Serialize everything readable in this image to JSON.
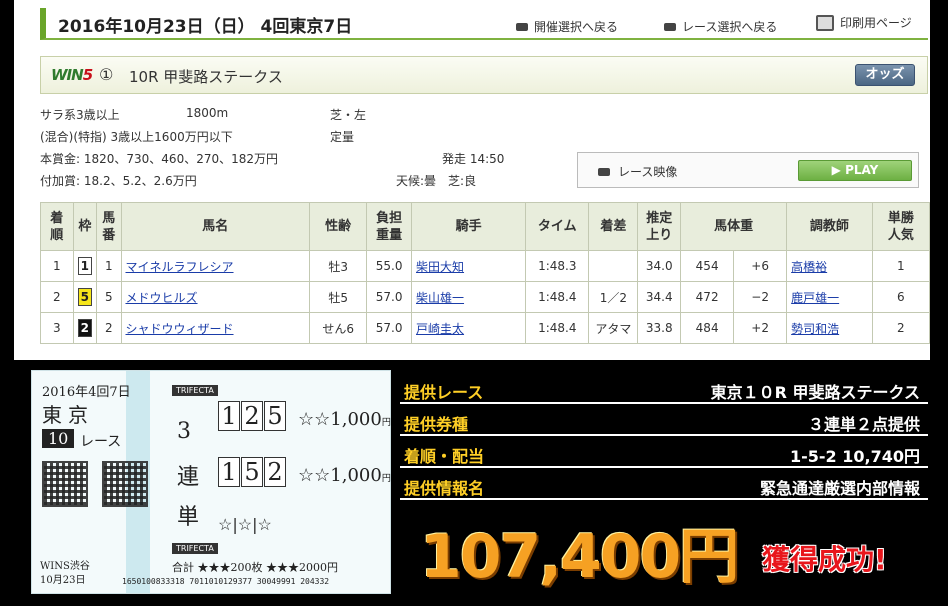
{
  "header": {
    "date_title": "2016年10月23日（日） 4回東京7日",
    "back_meeting": "開催選択へ戻る",
    "back_race": "レース選択へ戻る",
    "print_page": "印刷用ページ"
  },
  "race": {
    "win5_logo_a": "WIN",
    "win5_logo_b": "5",
    "leg": "①",
    "name": "10R 甲斐路ステークス",
    "odds_label": "オッズ",
    "class": "サラ系3歳以上",
    "distance": "1800m",
    "surface": "芝・左",
    "condition": "(混合)(特指) 3歳以上1600万円以下",
    "weight_rule": "定量",
    "prize": "本賞金:  1820、730、460、270、182万円",
    "start": "発走 14:50",
    "bonus": "付加賞:  18.2、5.2、2.6万円",
    "weather": "天候:曇　芝:良",
    "video_label": "レース映像",
    "play_label": "PLAY"
  },
  "table": {
    "headers": [
      "着\n順",
      "枠",
      "馬\n番",
      "馬名",
      "性齢",
      "負担\n重量",
      "騎手",
      "タイム",
      "着差",
      "推定\n上り",
      "馬体重",
      "",
      "調教師",
      "単勝\n人気"
    ],
    "rows": [
      {
        "pos": "1",
        "waku": "1",
        "uma": "1",
        "horse": "マイネルラフレシア",
        "sex": "牡3",
        "kg": "55.0",
        "jockey": "柴田大知",
        "time": "1:48.3",
        "margin": "",
        "agari": "34.0",
        "bw": "454",
        "diff": "+6",
        "trainer": "高橋裕",
        "pop": "1"
      },
      {
        "pos": "2",
        "waku": "5",
        "uma": "5",
        "horse": "メドウヒルズ",
        "sex": "牡5",
        "kg": "57.0",
        "jockey": "柴山雄一",
        "time": "1:48.4",
        "margin": "1／2",
        "agari": "34.4",
        "bw": "472",
        "diff": "−2",
        "trainer": "鹿戸雄一",
        "pop": "6"
      },
      {
        "pos": "3",
        "waku": "2",
        "uma": "2",
        "horse": "シャドウウィザード",
        "sex": "せん6",
        "kg": "57.0",
        "jockey": "戸崎圭太",
        "time": "1:48.4",
        "margin": "アタマ",
        "agari": "33.8",
        "bw": "484",
        "diff": "+2",
        "trainer": "勢司和浩",
        "pop": "2"
      }
    ]
  },
  "ticket": {
    "date": "2016年4回7日",
    "venue": "東京",
    "race_no": "10",
    "race_word": "レース",
    "type_top": "TRIFECTA",
    "type_kanji": [
      "3",
      "連",
      "単"
    ],
    "combo1": [
      "1",
      "2",
      "5"
    ],
    "combo2": [
      "1",
      "5",
      "2"
    ],
    "amount1": "1,000",
    "amount2": "1,000",
    "yen": "円",
    "stars": "☆|☆|☆",
    "type_bottom": "TRIFECTA",
    "total": "合計 ★★★200枚 ★★★2000円",
    "shop": "WINS渋谷",
    "shop_date": "10月23日",
    "serial": "1650100833318  7011010129377  30049991  204332"
  },
  "info": [
    {
      "label": "提供レース",
      "value": "東京１０R 甲斐路ステークス"
    },
    {
      "label": "提供券種",
      "value": "３連単２点提供"
    },
    {
      "label": "着順・配当",
      "value": "1-5-2 10,740円"
    },
    {
      "label": "提供情報名",
      "value": "緊急通達厳選内部情報"
    }
  ],
  "result": {
    "payout": "107,400円",
    "success": "獲得成功!"
  },
  "colors": {
    "accent_green": "#6aa52a",
    "label_yellow": "#ffcf26",
    "payout_orange": "#f6a123",
    "success_red": "#e8161c",
    "link_blue": "#1a3ca8"
  }
}
